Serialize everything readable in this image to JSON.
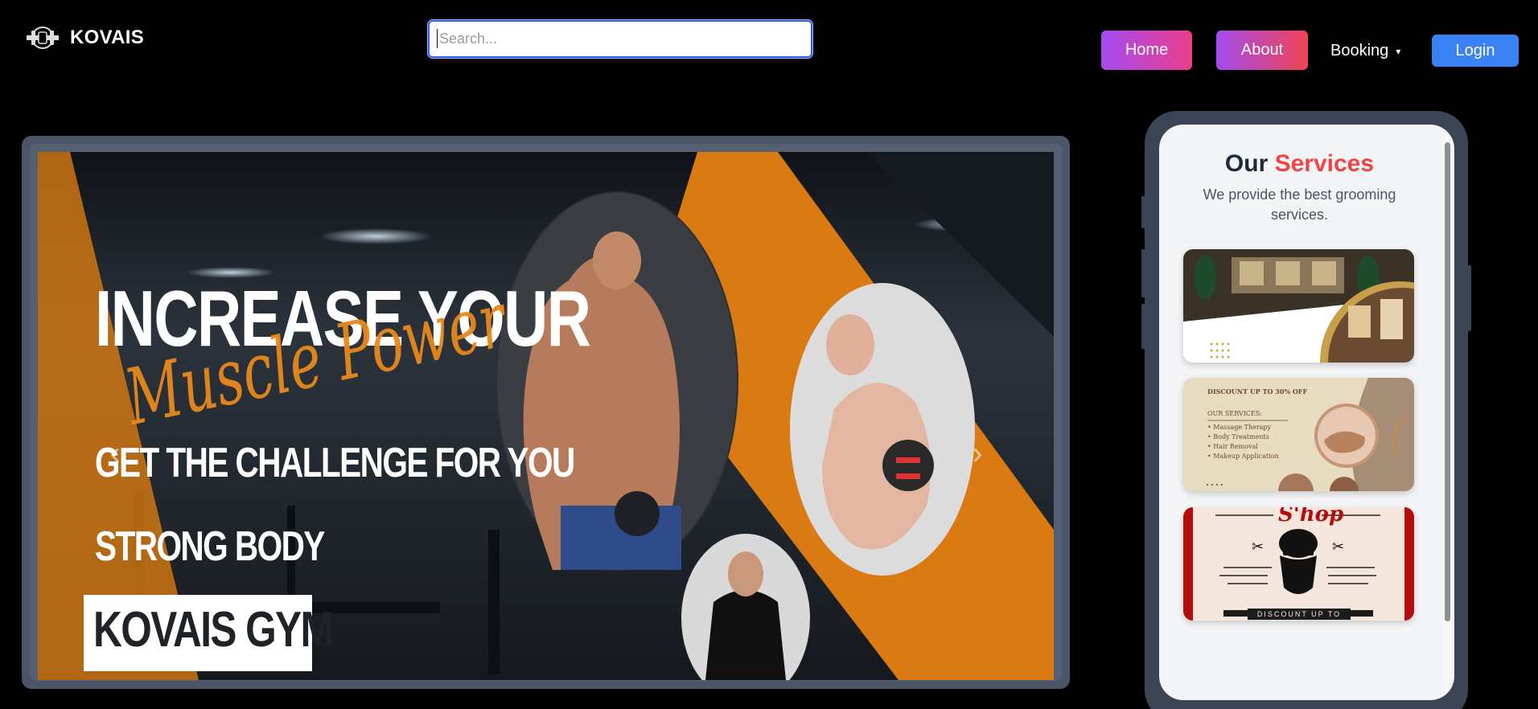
{
  "header": {
    "brand": "KOVAIS",
    "search_placeholder": "Search...",
    "nav": {
      "home": "Home",
      "about": "About",
      "booking": "Booking",
      "booking_caret": "▾",
      "login": "Login"
    }
  },
  "hero": {
    "line1": "INCREASE YOUR",
    "script": "Muscle Power",
    "line2": "GET THE CHALLENGE FOR YOU",
    "line3": "STRONG BODY",
    "brand": "KOVAIS GYM",
    "prev_arrow": "‹",
    "next_arrow": "›",
    "colors": {
      "accent": "#d97a12",
      "background": "#1c2026"
    }
  },
  "services": {
    "title_plain": "Our",
    "title_accent": "Services",
    "subtitle": "We provide the best grooming services.",
    "cards": [
      {
        "name": "salon-interior"
      },
      {
        "name": "spa-offer",
        "discount": "DISCOUNT UP TO 30% OFF",
        "heading": "OUR SERVICES:",
        "items": [
          "• Massage Therapy",
          "• Body Treatments",
          "• Hair Removal",
          "• Makeup Application"
        ]
      },
      {
        "name": "barber-shop",
        "script": "S'hop",
        "banner": "DISCOUNT UP TO"
      }
    ]
  }
}
